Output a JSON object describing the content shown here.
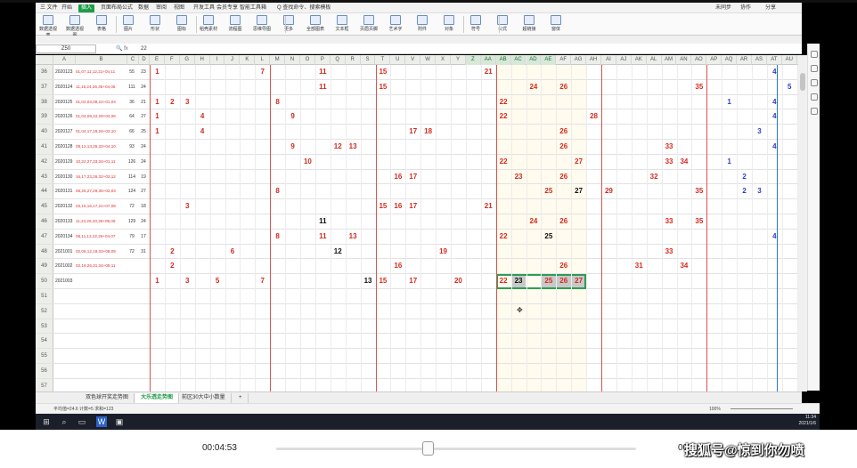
{
  "menu": {
    "items": [
      "三 文件",
      "开始",
      "插入",
      "页面布局",
      "公式",
      "数据",
      "审阅",
      "视图",
      "开发工具",
      "会员专享",
      "智能工具箱",
      "Q 查找命令、搜索模板"
    ],
    "active_index": 2,
    "right_items": [
      "未同步",
      "协作",
      "分享"
    ]
  },
  "ribbon": {
    "buttons": [
      "数据透视表",
      "数据透视图",
      "表格",
      "图片",
      "形状",
      "图标",
      "稻壳素材",
      "流程图",
      "思维导图",
      "更多",
      "全部图表",
      "文本框",
      "页眉页脚",
      "艺术字",
      "附件",
      "对象",
      "符号",
      "公式",
      "超链接",
      "窗体"
    ]
  },
  "formula_bar": {
    "name_box": "Z50",
    "fx": "fx",
    "value": "22"
  },
  "columns": [
    "A",
    "B",
    "C",
    "D",
    "E",
    "F",
    "G",
    "H",
    "I",
    "J",
    "K",
    "L",
    "M",
    "N",
    "O",
    "P",
    "Q",
    "R",
    "S",
    "T",
    "U",
    "V",
    "W",
    "X",
    "Y",
    "Z",
    "AA",
    "AB",
    "AC",
    "AD",
    "AE",
    "AF",
    "AG",
    "AH",
    "AI",
    "AJ",
    "AK",
    "AL",
    "AM",
    "AN",
    "AO",
    "AP",
    "AQ",
    "AR",
    "AS",
    "AT",
    "AU"
  ],
  "selected_columns": [
    "Z",
    "AA",
    "AB",
    "AC",
    "AD",
    "AE"
  ],
  "rows": [
    {
      "n": "36",
      "id": "2020123",
      "b": "01,07,11,12,21+04,11",
      "c": "55",
      "d": "23",
      "nums": [
        {
          "col": "E",
          "v": "1",
          "c": "r"
        },
        {
          "col": "L",
          "v": "7",
          "c": "r"
        },
        {
          "col": "P",
          "v": "11",
          "c": "r"
        },
        {
          "col": "T",
          "v": "15",
          "c": "r"
        },
        {
          "col": "AA",
          "v": "21",
          "c": "r"
        },
        {
          "col": "AT",
          "v": "4",
          "c": "u"
        }
      ]
    },
    {
      "n": "37",
      "id": "2020124",
      "b": "11,15,24,26,35+04,05",
      "c": "111",
      "d": "24",
      "nums": [
        {
          "col": "P",
          "v": "11",
          "c": "r"
        },
        {
          "col": "T",
          "v": "15",
          "c": "r"
        },
        {
          "col": "AD",
          "v": "24",
          "c": "r"
        },
        {
          "col": "AF",
          "v": "26",
          "c": "r"
        },
        {
          "col": "AO",
          "v": "35",
          "c": "r"
        },
        {
          "col": "AU",
          "v": "5",
          "c": "u"
        }
      ]
    },
    {
      "n": "38",
      "id": "2020125",
      "b": "01,02,03,08,22+01,04",
      "c": "36",
      "d": "21",
      "nums": [
        {
          "col": "E",
          "v": "1",
          "c": "r"
        },
        {
          "col": "F",
          "v": "2",
          "c": "r"
        },
        {
          "col": "G",
          "v": "3",
          "c": "r"
        },
        {
          "col": "M",
          "v": "8",
          "c": "r"
        },
        {
          "col": "AB",
          "v": "22",
          "c": "r"
        },
        {
          "col": "AQ",
          "v": "1",
          "c": "u"
        },
        {
          "col": "AT",
          "v": "4",
          "c": "u"
        }
      ]
    },
    {
      "n": "39",
      "id": "2020126",
      "b": "01,04,09,22,28+04,06",
      "c": "64",
      "d": "27",
      "nums": [
        {
          "col": "E",
          "v": "1",
          "c": "r"
        },
        {
          "col": "H",
          "v": "4",
          "c": "r"
        },
        {
          "col": "N",
          "v": "9",
          "c": "r"
        },
        {
          "col": "AB",
          "v": "22",
          "c": "r"
        },
        {
          "col": "AH",
          "v": "28",
          "c": "r"
        },
        {
          "col": "AT",
          "v": "4",
          "c": "u"
        }
      ]
    },
    {
      "n": "40",
      "id": "2020127",
      "b": "01,04,17,18,26+03,10",
      "c": "66",
      "d": "25",
      "nums": [
        {
          "col": "E",
          "v": "1",
          "c": "r"
        },
        {
          "col": "H",
          "v": "4",
          "c": "r"
        },
        {
          "col": "V",
          "v": "17",
          "c": "r"
        },
        {
          "col": "W",
          "v": "18",
          "c": "r"
        },
        {
          "col": "AF",
          "v": "26",
          "c": "r"
        },
        {
          "col": "AS",
          "v": "3",
          "c": "u"
        }
      ]
    },
    {
      "n": "41",
      "id": "2020128",
      "b": "09,12,13,26,33+04,10",
      "c": "93",
      "d": "24",
      "nums": [
        {
          "col": "N",
          "v": "9",
          "c": "r"
        },
        {
          "col": "Q",
          "v": "12",
          "c": "r"
        },
        {
          "col": "R",
          "v": "13",
          "c": "r"
        },
        {
          "col": "AF",
          "v": "26",
          "c": "r"
        },
        {
          "col": "AM",
          "v": "33",
          "c": "r"
        },
        {
          "col": "AT",
          "v": "4",
          "c": "u"
        }
      ]
    },
    {
      "n": "42",
      "id": "2020129",
      "b": "10,22,27,33,34+01,11",
      "c": "126",
      "d": "24",
      "nums": [
        {
          "col": "O",
          "v": "10",
          "c": "r"
        },
        {
          "col": "AB",
          "v": "22",
          "c": "r"
        },
        {
          "col": "AG",
          "v": "27",
          "c": "r"
        },
        {
          "col": "AM",
          "v": "33",
          "c": "r"
        },
        {
          "col": "AN",
          "v": "34",
          "c": "r"
        },
        {
          "col": "AQ",
          "v": "1",
          "c": "u"
        }
      ]
    },
    {
      "n": "43",
      "id": "2020130",
      "b": "16,17,23,26,32+02,12",
      "c": "114",
      "d": "19",
      "nums": [
        {
          "col": "U",
          "v": "16",
          "c": "r"
        },
        {
          "col": "V",
          "v": "17",
          "c": "r"
        },
        {
          "col": "AC",
          "v": "23",
          "c": "r"
        },
        {
          "col": "AF",
          "v": "26",
          "c": "r"
        },
        {
          "col": "AL",
          "v": "32",
          "c": "r"
        },
        {
          "col": "AR",
          "v": "2",
          "c": "u"
        }
      ]
    },
    {
      "n": "44",
      "id": "2020131",
      "b": "08,25,27,29,35+02,03",
      "c": "124",
      "d": "27",
      "nums": [
        {
          "col": "M",
          "v": "8",
          "c": "r"
        },
        {
          "col": "AE",
          "v": "25",
          "c": "r"
        },
        {
          "col": "AG",
          "v": "27",
          "c": "b"
        },
        {
          "col": "AI",
          "v": "29",
          "c": "r"
        },
        {
          "col": "AO",
          "v": "35",
          "c": "r"
        },
        {
          "col": "AR",
          "v": "2",
          "c": "u"
        },
        {
          "col": "AS",
          "v": "3",
          "c": "u"
        }
      ]
    },
    {
      "n": "45",
      "id": "2020132",
      "b": "03,15,16,17,21+07,08",
      "c": "72",
      "d": "18",
      "nums": [
        {
          "col": "G",
          "v": "3",
          "c": "r"
        },
        {
          "col": "T",
          "v": "15",
          "c": "r"
        },
        {
          "col": "U",
          "v": "16",
          "c": "r"
        },
        {
          "col": "V",
          "v": "17",
          "c": "r"
        },
        {
          "col": "AA",
          "v": "21",
          "c": "r"
        },
        {
          "col": "AX",
          "v": "7",
          "c": "u"
        }
      ]
    },
    {
      "n": "46",
      "id": "2020133",
      "b": "11,24,26,33,35+08,09",
      "c": "129",
      "d": "24",
      "nums": [
        {
          "col": "P",
          "v": "11",
          "c": "b"
        },
        {
          "col": "AD",
          "v": "24",
          "c": "r"
        },
        {
          "col": "AF",
          "v": "26",
          "c": "r"
        },
        {
          "col": "AM",
          "v": "33",
          "c": "r"
        },
        {
          "col": "AO",
          "v": "35",
          "c": "r"
        }
      ]
    },
    {
      "n": "47",
      "id": "2020134",
      "b": "08,11,13,22,25+04,07",
      "c": "79",
      "d": "17",
      "nums": [
        {
          "col": "M",
          "v": "8",
          "c": "r"
        },
        {
          "col": "P",
          "v": "11",
          "c": "r"
        },
        {
          "col": "R",
          "v": "13",
          "c": "r"
        },
        {
          "col": "AB",
          "v": "22",
          "c": "r"
        },
        {
          "col": "AE",
          "v": "25",
          "c": "b"
        },
        {
          "col": "AT",
          "v": "4",
          "c": "u"
        },
        {
          "col": "AX",
          "v": "7",
          "c": "u"
        }
      ]
    },
    {
      "n": "48",
      "id": "2021001",
      "b": "02,06,12,19,33+08,09",
      "c": "72",
      "d": "31",
      "nums": [
        {
          "col": "F",
          "v": "2",
          "c": "r"
        },
        {
          "col": "J",
          "v": "6",
          "c": "r"
        },
        {
          "col": "Q",
          "v": "12",
          "c": "b"
        },
        {
          "col": "X",
          "v": "19",
          "c": "r"
        },
        {
          "col": "AM",
          "v": "33",
          "c": "r"
        }
      ]
    },
    {
      "n": "49",
      "id": "2021002",
      "b": "02,16,26,31,34+09,11",
      "c": "",
      "d": "",
      "nums": [
        {
          "col": "F",
          "v": "2",
          "c": "r"
        },
        {
          "col": "U",
          "v": "16",
          "c": "r"
        },
        {
          "col": "AF",
          "v": "26",
          "c": "r"
        },
        {
          "col": "AK",
          "v": "31",
          "c": "r"
        },
        {
          "col": "AN",
          "v": "34",
          "c": "r"
        }
      ]
    },
    {
      "n": "50",
      "id": "2021003",
      "b": "",
      "c": "",
      "d": "",
      "nums": [
        {
          "col": "E",
          "v": "1",
          "c": "r"
        },
        {
          "col": "G",
          "v": "3",
          "c": "r"
        },
        {
          "col": "I",
          "v": "5",
          "c": "r"
        },
        {
          "col": "L",
          "v": "7",
          "c": "r"
        },
        {
          "col": "S",
          "v": "13",
          "c": "b"
        },
        {
          "col": "T",
          "v": "15",
          "c": "r"
        },
        {
          "col": "V",
          "v": "17",
          "c": "r"
        },
        {
          "col": "Y",
          "v": "20",
          "c": "r"
        },
        {
          "col": "AB",
          "v": "22",
          "c": "r"
        },
        {
          "col": "AC",
          "v": "23",
          "c": "b"
        },
        {
          "col": "AE",
          "v": "25",
          "c": "r"
        },
        {
          "col": "AF",
          "v": "26",
          "c": "r"
        },
        {
          "col": "AG",
          "v": "27",
          "c": "r"
        }
      ]
    },
    {
      "n": "51",
      "id": "",
      "b": "",
      "c": "",
      "d": "",
      "nums": []
    },
    {
      "n": "52",
      "id": "",
      "b": "",
      "c": "",
      "d": "",
      "nums": []
    },
    {
      "n": "53",
      "id": "",
      "b": "",
      "c": "",
      "d": "",
      "nums": []
    },
    {
      "n": "54",
      "id": "",
      "b": "",
      "c": "",
      "d": "",
      "nums": []
    },
    {
      "n": "55",
      "id": "",
      "b": "",
      "c": "",
      "d": "",
      "nums": []
    },
    {
      "n": "56",
      "id": "",
      "b": "",
      "c": "",
      "d": "",
      "nums": []
    },
    {
      "n": "57",
      "id": "",
      "b": "",
      "c": "",
      "d": "",
      "nums": []
    },
    {
      "n": "58",
      "id": "",
      "b": "",
      "c": "",
      "d": "",
      "nums": []
    },
    {
      "n": "59",
      "id": "",
      "b": "",
      "c": "",
      "d": "",
      "nums": []
    }
  ],
  "sheet_tabs": [
    "双色球开奖走势图",
    "大乐透走势图",
    "前区30大中小数量"
  ],
  "active_tab": 1,
  "status": {
    "left": "平均值=24.6  计数=5  求和=123",
    "zoom": "100%"
  },
  "clock": {
    "time": "11:34",
    "date": "2021/1/6"
  },
  "video": {
    "current": "00:04:53",
    "end": "00",
    "progress": 0.42
  },
  "watermark": "搜狐号@惊到你勿喷",
  "colors": {
    "red": "#d42a1e",
    "blue": "#2a3fc8",
    "black": "#111",
    "accent": "#1e9d49"
  }
}
